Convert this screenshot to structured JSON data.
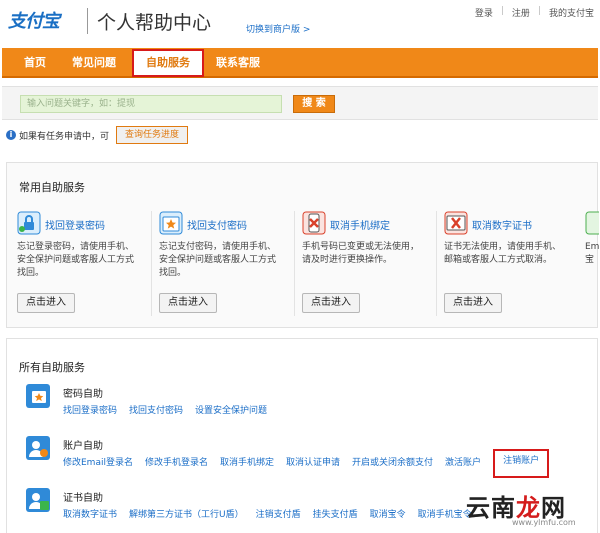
{
  "header": {
    "logo_text": "支付宝",
    "title": "个人帮助中心",
    "switch_link": "切换到商户版 >",
    "links": [
      "登录",
      "注册",
      "我的支付宝"
    ]
  },
  "nav": {
    "items": [
      "首页",
      "常见问题",
      "自助服务",
      "联系客服"
    ],
    "active": "自助服务"
  },
  "search": {
    "placeholder": "输入问题关键字，如：提现",
    "button": "搜 索"
  },
  "task": {
    "notice": "如果有任务申请中，可",
    "button": "查询任务进度"
  },
  "common_services": {
    "title": "常用自助服务",
    "items": [
      {
        "name": "找回登录密码",
        "desc": "忘记登录密码，请使用手机、安全保护问题或客服人工方式找回。",
        "button": "点击进入",
        "icon": "lock-key-icon",
        "color": "#2f8ad8"
      },
      {
        "name": "找回支付密码",
        "desc": "忘记支付密码，请使用手机、安全保护问题或客服人工方式找回。",
        "button": "点击进入",
        "icon": "star-lock-icon",
        "color": "#2f8ad8"
      },
      {
        "name": "取消手机绑定",
        "desc": "手机号码已变更或无法使用，请及时进行更换操作。",
        "button": "点击进入",
        "icon": "phone-x-icon",
        "color": "#d9412b"
      },
      {
        "name": "取消数字证书",
        "desc": "证书无法使用，请使用手机、邮箱或客服人工方式取消。",
        "button": "点击进入",
        "icon": "cert-x-icon",
        "color": "#d9412b"
      },
      {
        "name": "Ema",
        "desc": "Ema宝",
        "button": "",
        "icon": "email-icon",
        "color": "#4caf50"
      }
    ]
  },
  "all_services": {
    "title": "所有自助服务",
    "groups": [
      {
        "title": "密码自助",
        "icon": "password-icon",
        "links": [
          "找回登录密码",
          "找回支付密码",
          "设置安全保护问题"
        ]
      },
      {
        "title": "账户自助",
        "icon": "account-icon",
        "links": [
          "修改Email登录名",
          "修改手机登录名",
          "取消手机绑定",
          "取消认证申请",
          "开启或关闭余额支付",
          "激活账户",
          "注销账户"
        ]
      },
      {
        "title": "证书自助",
        "icon": "certificate-icon",
        "links": [
          "取消数字证书",
          "解绑第三方证书（工行U盾）",
          "注销支付盾",
          "挂失支付盾",
          "取消宝令",
          "取消手机宝令"
        ]
      }
    ]
  },
  "watermark": {
    "text_black": "云南",
    "text_red": "龙",
    "text_black2": "网",
    "sub": "www.ylmfu.com"
  },
  "colors": {
    "brand_orange": "#f08818",
    "link_blue": "#1b6ec7",
    "highlight_red": "#d71a1a"
  }
}
